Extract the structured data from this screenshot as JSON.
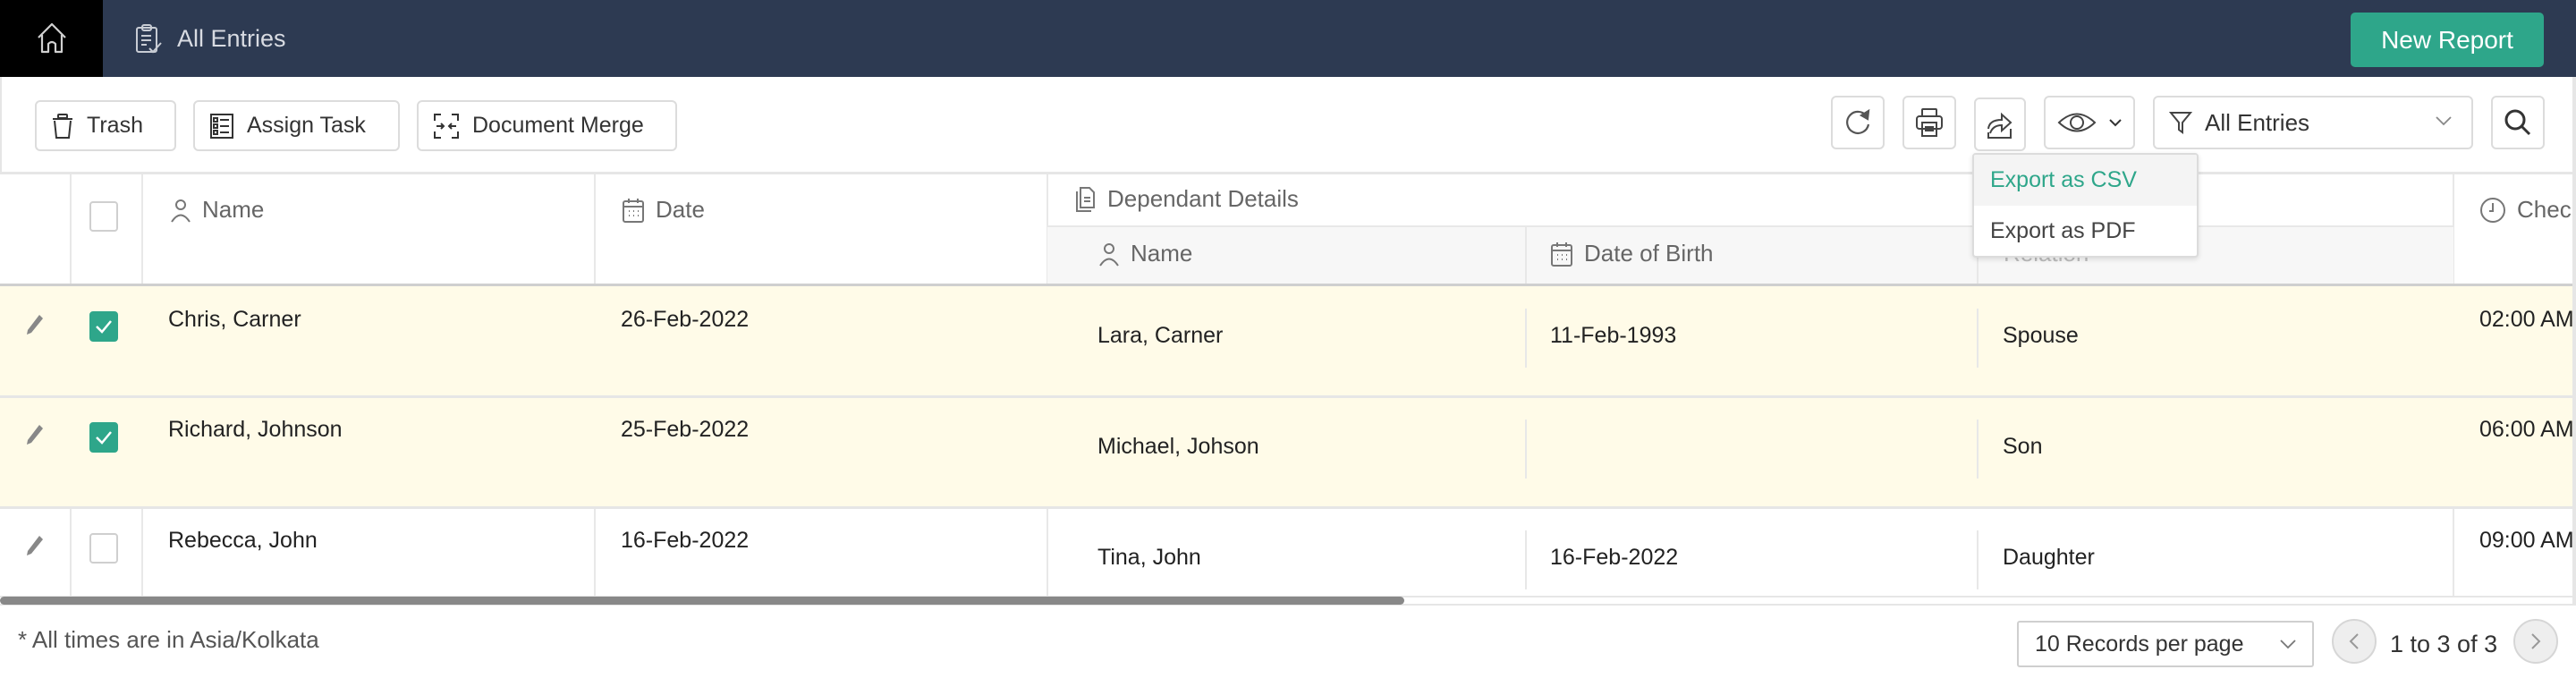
{
  "header": {
    "title": "All Entries",
    "new_report_label": "New Report",
    "home_icon": "home-icon",
    "title_icon": "clipboard-check-icon"
  },
  "toolbar": {
    "trash_label": "Trash",
    "assign_task_label": "Assign Task",
    "document_merge_label": "Document Merge",
    "icons": [
      "refresh-icon",
      "print-icon",
      "export-icon",
      "eye-icon",
      "search-icon"
    ],
    "filter": {
      "selected": "All Entries"
    }
  },
  "export_menu": {
    "items": [
      {
        "label": "Export as CSV",
        "active": true
      },
      {
        "label": "Export as PDF",
        "active": false
      }
    ]
  },
  "table": {
    "columns": {
      "name": "Name",
      "date": "Date",
      "group": "Dependant Details",
      "dep_name": "Name",
      "dob": "Date of Birth",
      "relation": "Relation",
      "check": "Chec"
    },
    "rows": [
      {
        "selected": true,
        "name": "Chris, Carner",
        "date": "26-Feb-2022",
        "dep_name": "Lara, Carner",
        "dob": "11-Feb-1993",
        "relation": "Spouse",
        "check": "02:00 AM"
      },
      {
        "selected": true,
        "name": "Richard, Johnson",
        "date": "25-Feb-2022",
        "dep_name": "Michael, Johson",
        "dob": "",
        "relation": "Son",
        "check": "06:00 AM"
      },
      {
        "selected": false,
        "name": "Rebecca, John",
        "date": "16-Feb-2022",
        "dep_name": "Tina, John",
        "dob": "16-Feb-2022",
        "relation": "Daughter",
        "check": "09:00 AM"
      }
    ]
  },
  "footer": {
    "timezone_note": "* All times are in Asia/Kolkata",
    "per_page": "10 Records per page",
    "pagination": "1 to 3 of 3"
  },
  "colors": {
    "header_bg": "#2d3a52",
    "accent": "#2ea68a",
    "selected_row_bg": "#fffbe8"
  }
}
